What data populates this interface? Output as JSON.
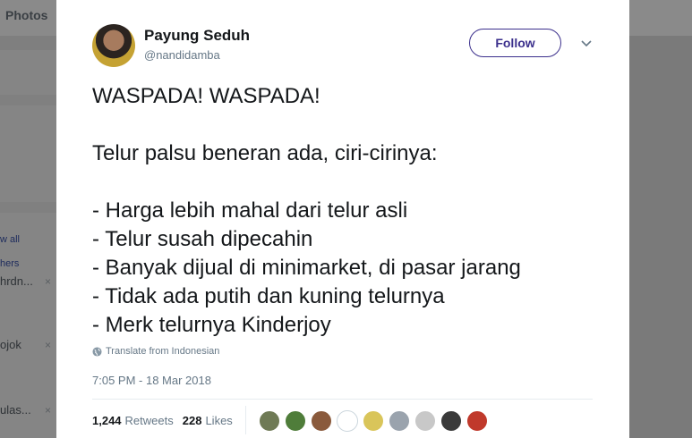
{
  "background": {
    "tab_label": "Photos",
    "sidebar_link_1": "w all",
    "sidebar_link_2": "hers",
    "sidebar_text_1": "hrdn...",
    "sidebar_text_2": "ojok",
    "sidebar_text_3": "ulas...",
    "close_glyph": "×"
  },
  "tweet": {
    "author_name": "Payung Seduh",
    "author_handle": "@nandidamba",
    "follow_label": "Follow",
    "text": "WASPADA! WASPADA!\n\nTelur palsu beneran ada, ciri-cirinya:\n\n- Harga lebih mahal dari telur asli\n- Telur susah dipecahin\n- Banyak dijual di minimarket, di pasar jarang\n- Tidak ada putih dan kuning telurnya\n- Merk telurnya Kinderjoy",
    "translate_label": "Translate from Indonesian",
    "timestamp": "7:05 PM - 18 Mar 2018",
    "retweets_count": "1,244",
    "retweets_label": "Retweets",
    "likes_count": "228",
    "likes_label": "Likes"
  },
  "likers": [
    {
      "name": "liker-1",
      "color": "#6f7a55"
    },
    {
      "name": "liker-2",
      "color": "#4f7d3a"
    },
    {
      "name": "liker-3",
      "color": "#8a5a3c"
    },
    {
      "name": "liker-4",
      "color": "#ffffff"
    },
    {
      "name": "liker-5",
      "color": "#d9c55a"
    },
    {
      "name": "liker-6",
      "color": "#9aa3ad"
    },
    {
      "name": "liker-7",
      "color": "#c8c8c8"
    },
    {
      "name": "liker-8",
      "color": "#3a3a3a"
    },
    {
      "name": "liker-9",
      "color": "#c0392b"
    }
  ],
  "colors": {
    "accent": "#3b2f8c",
    "text_primary": "#14171a",
    "text_secondary": "#657786"
  },
  "icons": {
    "caret": "chevron-down-icon",
    "globe": "globe-icon"
  }
}
